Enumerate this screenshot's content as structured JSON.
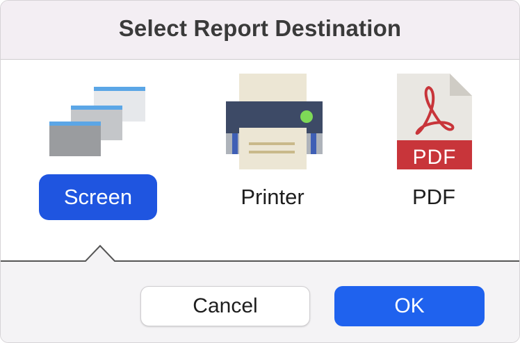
{
  "dialog": {
    "title": "Select Report Destination"
  },
  "destinations": [
    {
      "label": "Screen",
      "icon": "screen-windows-icon",
      "selected": true
    },
    {
      "label": "Printer",
      "icon": "printer-icon",
      "selected": false
    },
    {
      "label": "PDF",
      "icon": "pdf-file-icon",
      "selected": false
    }
  ],
  "buttons": {
    "cancel_label": "Cancel",
    "ok_label": "OK"
  },
  "colors": {
    "accent": "#1f55e0",
    "ok_button": "#1f62ee",
    "pdf_red": "#c8353a",
    "printer_navy": "#3d4a66",
    "printer_led": "#7ed957"
  }
}
